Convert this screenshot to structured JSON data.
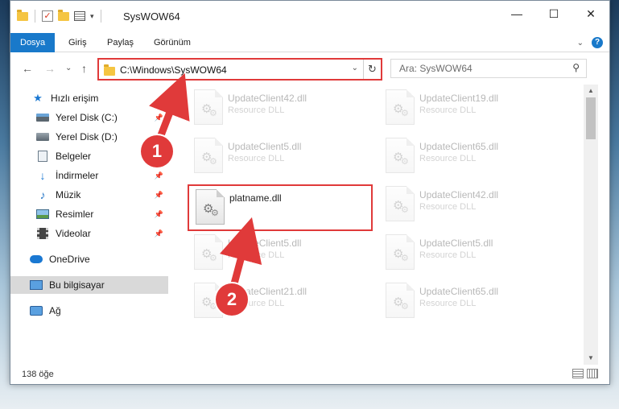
{
  "window": {
    "title": "SysWOW64",
    "controls": {
      "minimize": "—",
      "maximize": "☐",
      "close": "✕"
    }
  },
  "ribbon": {
    "tabs": [
      "Dosya",
      "Giriş",
      "Paylaş",
      "Görünüm"
    ],
    "active_tab": "Dosya",
    "expand": "⌄",
    "help": "?"
  },
  "addressbar": {
    "path": "C:\\Windows\\SysWOW64",
    "back": "←",
    "forward": "→",
    "recent": "⌄",
    "up": "↑",
    "dropdown": "⌄",
    "refresh": "↻"
  },
  "search": {
    "placeholder": "Ara: SysWOW64",
    "icon": "⚲"
  },
  "sidebar": {
    "items": [
      {
        "label": "Hızlı erişim",
        "icon": "star-icon"
      },
      {
        "label": "Yerel Disk (C:)",
        "icon": "drive-c-icon",
        "pinned": true
      },
      {
        "label": "Yerel Disk (D:)",
        "icon": "drive-d-icon",
        "pinned": true
      },
      {
        "label": "Belgeler",
        "icon": "documents-icon",
        "pinned": true
      },
      {
        "label": "İndirmeler",
        "icon": "downloads-icon",
        "pinned": true
      },
      {
        "label": "Müzik",
        "icon": "music-icon",
        "pinned": true
      },
      {
        "label": "Resimler",
        "icon": "pictures-icon",
        "pinned": true
      },
      {
        "label": "Videolar",
        "icon": "videos-icon",
        "pinned": true
      },
      {
        "label": "OneDrive",
        "icon": "onedrive-icon"
      },
      {
        "label": "Bu bilgisayar",
        "icon": "this-pc-icon",
        "selected": true
      },
      {
        "label": "Ağ",
        "icon": "network-icon"
      }
    ]
  },
  "files": [
    {
      "name": "UpdateClient42.dll",
      "type": "Resource DLL"
    },
    {
      "name": "UpdateClient19.dll",
      "type": "Resource DLL"
    },
    {
      "name": "UpdateClient5.dll",
      "type": "Resource DLL"
    },
    {
      "name": "UpdateClient65.dll",
      "type": "Resource DLL"
    },
    {
      "name": "platname.dll",
      "type": "",
      "highlighted": true
    },
    {
      "name": "UpdateClient42.dll",
      "type": "Resource DLL"
    },
    {
      "name": "UpdateClient5.dll",
      "type": "Resource DLL"
    },
    {
      "name": "UpdateClient5.dll",
      "type": "Resource DLL"
    },
    {
      "name": "UpdateClient21.dll",
      "type": "Resource DLL"
    },
    {
      "name": "UpdateClient65.dll",
      "type": "Resource DLL"
    }
  ],
  "status": {
    "count": "138 öğe"
  },
  "annotations": {
    "step1": "1",
    "step2": "2",
    "accent_color": "#e03a3a"
  }
}
